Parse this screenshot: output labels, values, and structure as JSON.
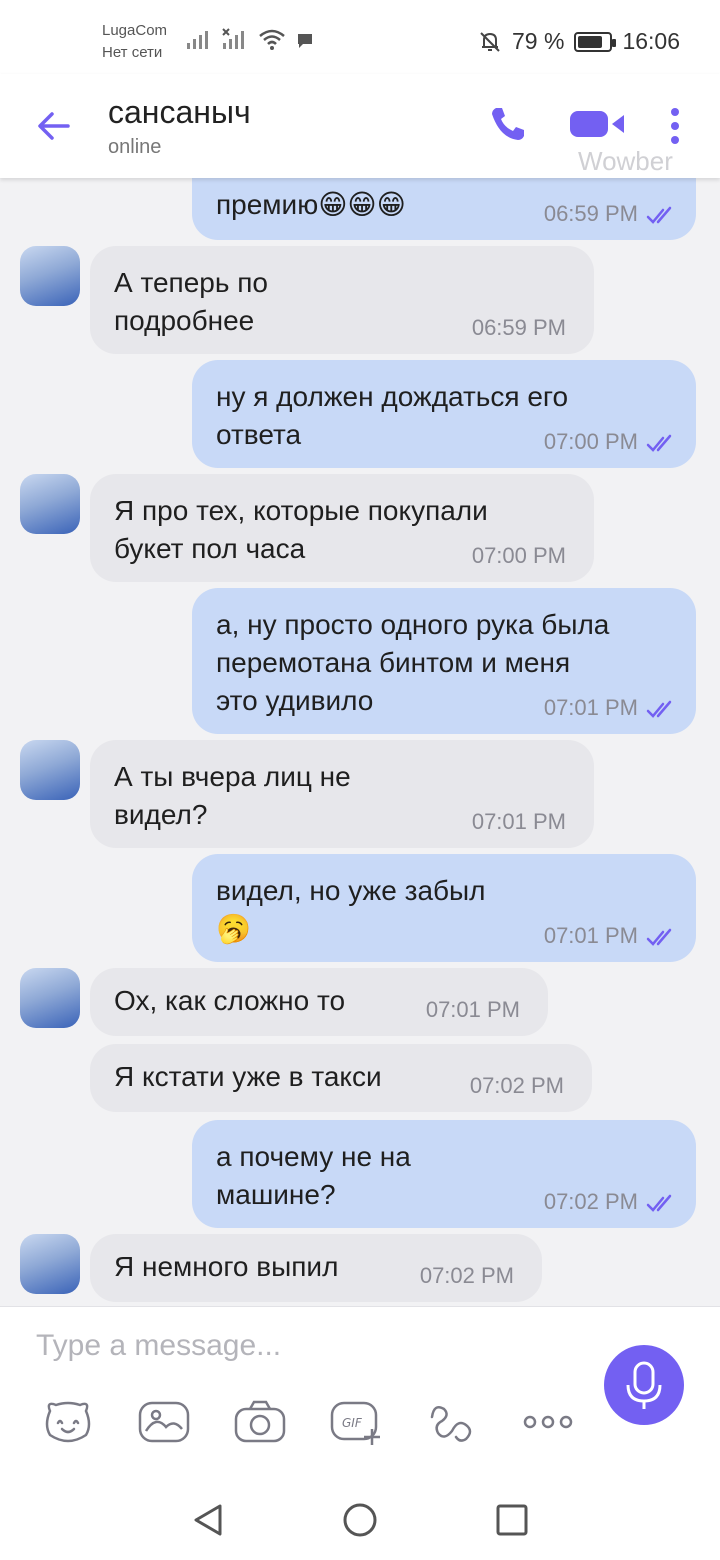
{
  "status_bar": {
    "carrier": "LugaCom",
    "network_status": "Нет сети",
    "battery_percent": "79 %",
    "battery_level": 0.79,
    "time": "16:06"
  },
  "header": {
    "contact_name": "сансаныч",
    "contact_status": "online",
    "watermark": "Wowber"
  },
  "colors": {
    "accent": "#7360f2",
    "incoming_bubble": "#e7e7eb",
    "outgoing_bubble": "#c8d9f7",
    "background": "#f2f2f4"
  },
  "messages": [
    {
      "dir": "out",
      "text": "премию😁😁😁",
      "time": "06:59 PM",
      "read": true,
      "partial": true
    },
    {
      "dir": "in",
      "text": "А теперь по\nподробнее",
      "time": "06:59 PM",
      "avatar": true
    },
    {
      "dir": "out",
      "text": "ну я должен дождаться его\nответа",
      "time": "07:00 PM",
      "read": true
    },
    {
      "dir": "in",
      "text": "Я про тех, которые покупали\nбукет пол часа",
      "time": "07:00 PM",
      "avatar": true
    },
    {
      "dir": "out",
      "text": "а, ну просто одного рука была\nперемотана бинтом и меня\nэто удивило",
      "time": "07:01 PM",
      "read": true
    },
    {
      "dir": "in",
      "text": "А ты вчера лиц не\nвидел?",
      "time": "07:01 PM",
      "avatar": true
    },
    {
      "dir": "out",
      "text": "видел, но уже забыл\n🥱",
      "time": "07:01 PM",
      "read": true
    },
    {
      "dir": "in",
      "text": "Ох, как сложно то",
      "time": "07:01 PM",
      "avatar": true
    },
    {
      "dir": "in",
      "text": "Я кстати уже в такси",
      "time": "07:02 PM",
      "avatar": false
    },
    {
      "dir": "out",
      "text": "а почему не на\nмашине?",
      "time": "07:02 PM",
      "read": true
    },
    {
      "dir": "in",
      "text": "Я немного выпил",
      "time": "07:02 PM",
      "avatar": true
    }
  ],
  "composer": {
    "placeholder": "Type a message...",
    "tools": [
      "sticker-icon",
      "gallery-icon",
      "camera-icon",
      "gif-icon",
      "doodle-icon",
      "more-options-icon"
    ],
    "mic_icon": "microphone-icon"
  },
  "navbar": {
    "buttons": [
      "back-nav-icon",
      "home-nav-icon",
      "recents-nav-icon"
    ]
  }
}
